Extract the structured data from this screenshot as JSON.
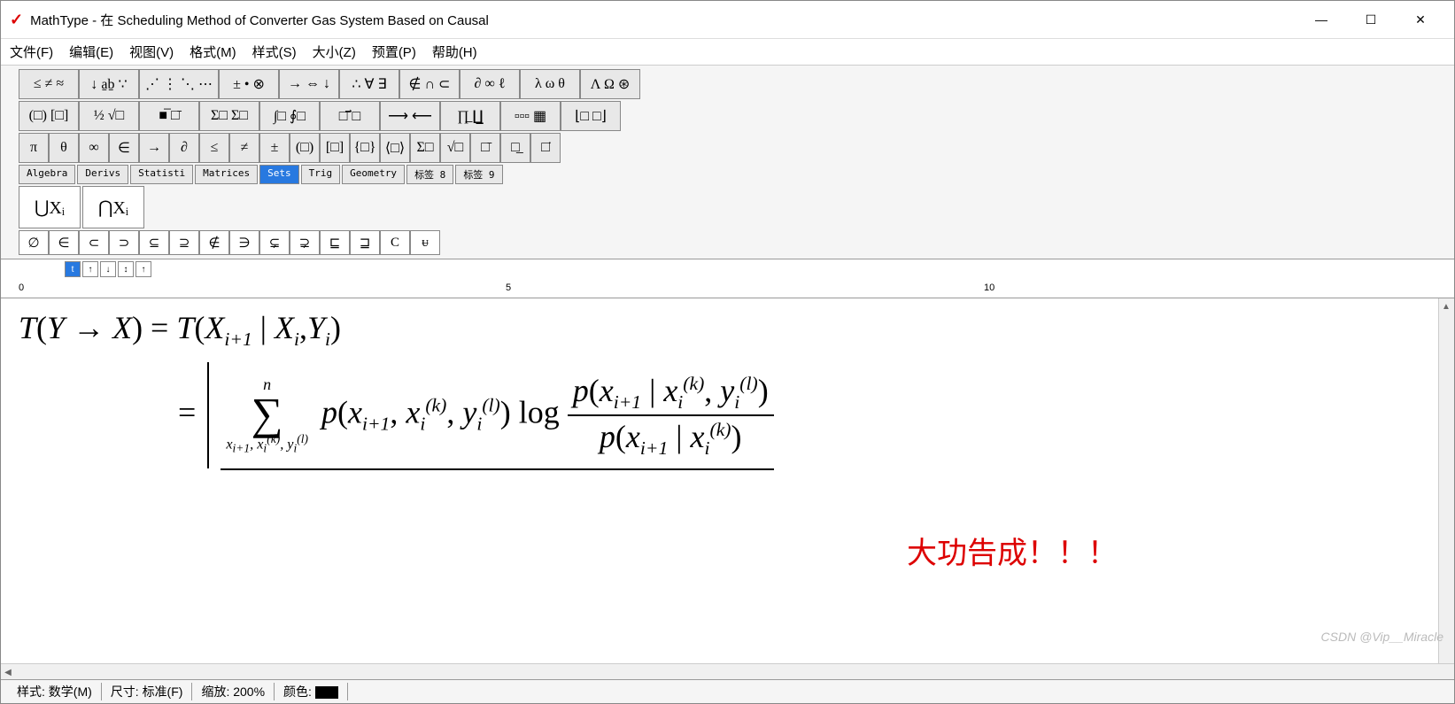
{
  "window": {
    "app_icon": "✓",
    "title": "MathType - 在 Scheduling Method of Converter Gas System Based on Causal"
  },
  "menu": {
    "file": "文件(F)",
    "edit": "编辑(E)",
    "view": "视图(V)",
    "format": "格式(M)",
    "style": "样式(S)",
    "size": "大小(Z)",
    "preset": "预置(P)",
    "help": "帮助(H)"
  },
  "toolbar_row1": [
    "≤ ≠ ≈",
    "↓ a̱ḇ ∵",
    "⋰ ⋮ ⋱ ⋯",
    "± • ⊗",
    "→ ⇔ ↓",
    "∴ ∀ ∃",
    "∉ ∩ ⊂",
    "∂ ∞ ℓ",
    "λ ω θ",
    "Λ Ω ⊛"
  ],
  "toolbar_row2": [
    "(□) [□]",
    "½ √□",
    "■̅ □̄",
    "Σ□ Σ□",
    "∫□ ∮□",
    "□̄ ⃗□",
    "⟶ ⟵",
    "∏̲ ∐̲",
    "▫▫▫ ▦",
    "⌊□ □⌋"
  ],
  "toolbar_row3": [
    "π",
    "θ",
    "∞",
    "∈",
    "→",
    "∂",
    "≤",
    "≠",
    "±",
    "(□)",
    "[□]",
    "{□}",
    "⟨□⟩",
    "Σ□",
    "√□",
    "□̄",
    "□̲",
    "□̇"
  ],
  "tabs": [
    "Algebra",
    "Derivs",
    "Statisti",
    "Matrices",
    "Sets",
    "Trig",
    "Geometry",
    "标签 8",
    "标签 9"
  ],
  "active_tab": "Sets",
  "big_templates": [
    "⋃Xᵢ",
    "⋂Xᵢ"
  ],
  "small_templates": [
    "∅",
    "∈",
    "⊂",
    "⊃",
    "⊆",
    "⊇",
    "∉",
    "∋",
    "⊊",
    "⊋",
    "⊑",
    "⊒",
    "C",
    "ᵾ"
  ],
  "ruler": {
    "mark1": "0",
    "mark2": "5",
    "mark3": "10"
  },
  "formula": {
    "line1": "T(Y → X) = T(X_{i+1} | X_i, Y_i)",
    "eq": "=",
    "sum_top": "n",
    "sum_bottom": "x_{i+1}, x_i^{(k)}, y_i^{(l)}",
    "p_joint": "p(x_{i+1}, x_i^{(k)}, y_i^{(l)}) log",
    "frac_num": "p(x_{i+1} | x_i^{(k)}, y_i^{(l)})",
    "frac_den": "p(x_{i+1} | x_i^{(k)})"
  },
  "annotation": "大功告成！！！",
  "status": {
    "style_label": "样式:",
    "style_value": "数学(M)",
    "size_label": "尺寸:",
    "size_value": "标准(F)",
    "zoom_label": "缩放:",
    "zoom_value": "200%",
    "color_label": "颜色:"
  },
  "watermark": "CSDN @Vip__Miracle"
}
